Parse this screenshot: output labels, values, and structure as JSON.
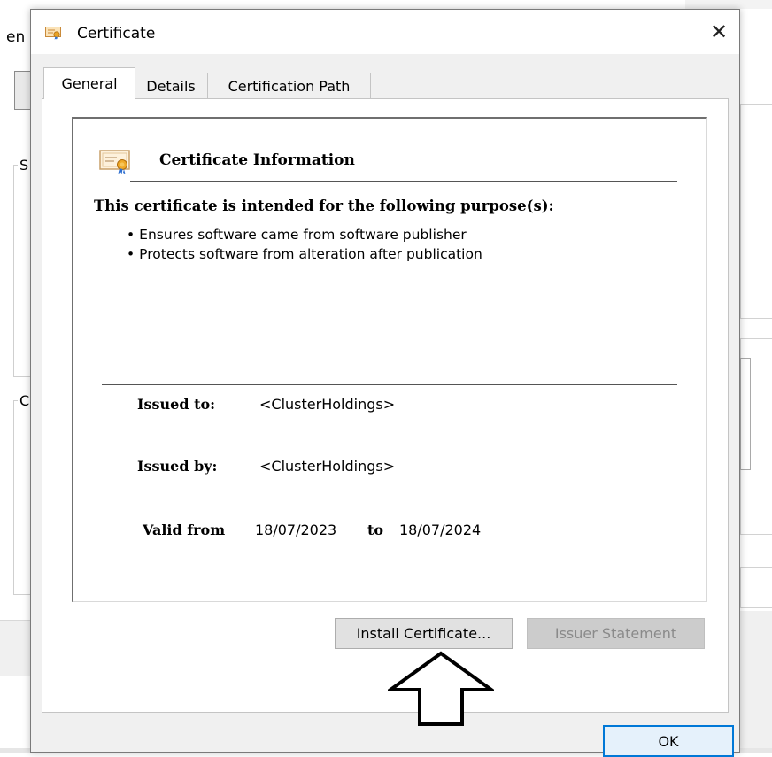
{
  "background": {
    "left_fragment_text": "en",
    "group_label_s": "S",
    "group_label_c": "C"
  },
  "dialog": {
    "title": "Certificate",
    "close_glyph": "✕",
    "tabs": [
      {
        "label": "General",
        "active": true
      },
      {
        "label": "Details",
        "active": false
      },
      {
        "label": "Certification Path",
        "active": false
      }
    ],
    "info": {
      "header": "Certificate Information",
      "purpose_heading": "This certificate is intended for the following purpose(s):",
      "purposes": [
        "Ensures software came from software publisher",
        "Protects software from alteration after publication"
      ],
      "issued_to_label": "Issued to:",
      "issued_to_value": "<ClusterHoldings>",
      "issued_by_label": "Issued by:",
      "issued_by_value": "<ClusterHoldings>",
      "valid_from_label": "Valid from",
      "valid_from_value": "18/07/2023",
      "valid_to_label": "to",
      "valid_to_value": "18/07/2024"
    },
    "buttons": {
      "install": "Install Certificate...",
      "issuer": "Issuer Statement",
      "ok": "OK"
    }
  },
  "colors": {
    "accent": "#0078d7",
    "dialog_bg": "#f0f0f0",
    "disabled_text": "#8a8a8a"
  },
  "icons": {
    "title": "certificate-icon",
    "info": "certificate-icon",
    "annotation": "up-arrow-icon"
  }
}
